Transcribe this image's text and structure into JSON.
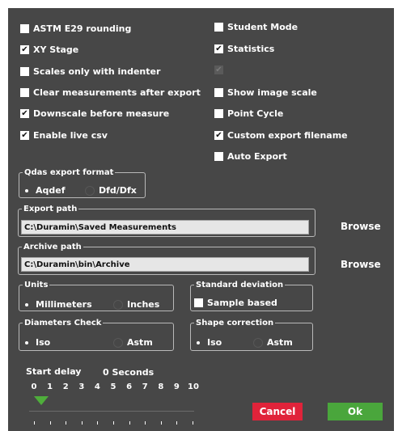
{
  "options": {
    "left": [
      {
        "label": "ASTM E29 rounding",
        "checked": false
      },
      {
        "label": "XY Stage",
        "checked": true
      },
      {
        "label": "Scales only with indenter",
        "checked": false
      },
      {
        "label": "Clear measurements after export",
        "checked": false
      },
      {
        "label": "Downscale before measure",
        "checked": true
      },
      {
        "label": "Enable live csv",
        "checked": true
      }
    ],
    "right": [
      {
        "label": "Student Mode",
        "checked": false
      },
      {
        "label": "Statistics",
        "checked": true
      },
      {
        "label": "",
        "checked": true,
        "disabled": true
      },
      {
        "label": "Show image scale",
        "checked": false
      },
      {
        "label": "Point Cycle",
        "checked": false
      },
      {
        "label": "Custom export filename",
        "checked": true
      },
      {
        "label": "Auto Export",
        "checked": false
      }
    ]
  },
  "qdas": {
    "title": "Qdas export format",
    "options": [
      {
        "label": "Aqdef",
        "selected": true
      },
      {
        "label": "Dfd/Dfx",
        "selected": false
      }
    ]
  },
  "export_path": {
    "title": "Export path",
    "value": "C:\\Duramin\\Saved Measurements",
    "browse": "Browse"
  },
  "archive_path": {
    "title": "Archive path",
    "value": "C:\\Duramin\\bin\\Archive",
    "browse": "Browse"
  },
  "units": {
    "title": "Units",
    "options": [
      {
        "label": "Millimeters",
        "selected": true
      },
      {
        "label": "Inches",
        "selected": false
      }
    ]
  },
  "standard_deviation": {
    "title": "Standard deviation",
    "checkbox": {
      "label": "Sample based",
      "checked": false
    }
  },
  "diameters_check": {
    "title": "Diameters Check",
    "options": [
      {
        "label": "Iso",
        "selected": true
      },
      {
        "label": "Astm",
        "selected": false
      }
    ]
  },
  "shape_correction": {
    "title": "Shape correction",
    "options": [
      {
        "label": "Iso",
        "selected": true
      },
      {
        "label": "Astm",
        "selected": false
      }
    ]
  },
  "start_delay": {
    "label": "Start delay",
    "value_text": "0 Seconds",
    "value": 0,
    "min": 0,
    "max": 10,
    "ticks": [
      "0",
      "1",
      "2",
      "3",
      "4",
      "5",
      "6",
      "7",
      "8",
      "9",
      "10"
    ]
  },
  "buttons": {
    "cancel": "Cancel",
    "ok": "Ok"
  },
  "colors": {
    "panel": "#474747",
    "cancel": "#e0233a",
    "ok": "#4aa63c",
    "slider_thumb": "#4fae3b"
  }
}
